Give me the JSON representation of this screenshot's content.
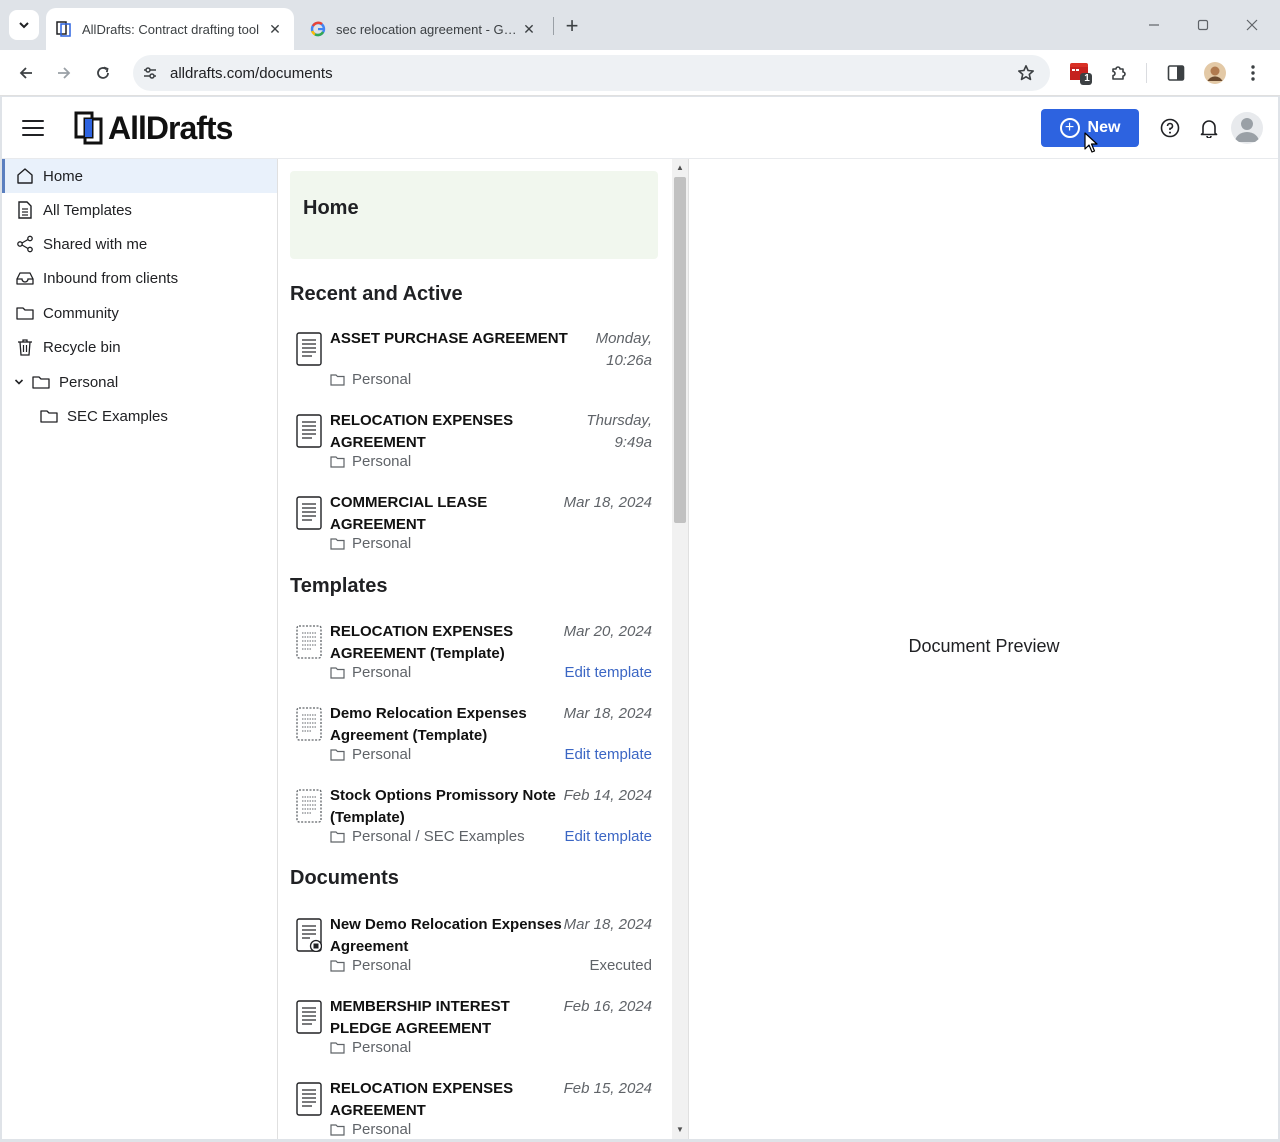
{
  "browser": {
    "tabs": [
      {
        "title": "AllDrafts: Contract drafting tool",
        "active": true
      },
      {
        "title": "sec relocation agreement - Google Search",
        "active": false
      }
    ],
    "url": "alldrafts.com/documents",
    "extension_badge": "1"
  },
  "app": {
    "logo_text": "AllDrafts",
    "new_button_label": "New",
    "brand_color": "#2d63e0"
  },
  "sidebar": {
    "items": [
      {
        "label": "Home",
        "icon": "home-icon"
      },
      {
        "label": "All Templates",
        "icon": "document-icon"
      },
      {
        "label": "Shared with me",
        "icon": "share-icon"
      },
      {
        "label": "Inbound from clients",
        "icon": "inbox-icon"
      },
      {
        "label": "Community",
        "icon": "folder-icon"
      },
      {
        "label": "Recycle bin",
        "icon": "trash-icon"
      },
      {
        "label": "Personal",
        "icon": "folder-icon"
      },
      {
        "label": "SEC Examples",
        "icon": "folder-icon"
      }
    ]
  },
  "home": {
    "title": "Home",
    "recent_title": "Recent and Active",
    "recent": [
      {
        "name": "ASSET PURCHASE AGREEMENT",
        "date": "Monday, 10:26a",
        "folder": "Personal"
      },
      {
        "name": "RELOCATION EXPENSES AGREEMENT",
        "date": "Thursday, 9:49a",
        "folder": "Personal"
      },
      {
        "name": "COMMERCIAL LEASE AGREEMENT",
        "date": "Mar 18, 2024",
        "folder": "Personal"
      }
    ],
    "templates_title": "Templates",
    "templates": [
      {
        "name": "RELOCATION EXPENSES AGREEMENT (Template)",
        "date": "Mar 20, 2024",
        "folder": "Personal",
        "action": "Edit template"
      },
      {
        "name": "Demo Relocation Expenses Agreement (Template)",
        "date": "Mar 18, 2024",
        "folder": "Personal",
        "action": "Edit template"
      },
      {
        "name": "Stock Options Promissory Note (Template)",
        "date": "Feb 14, 2024",
        "folder": "Personal / SEC Examples",
        "action": "Edit template"
      }
    ],
    "documents_title": "Documents",
    "documents": [
      {
        "name": "New Demo Relocation Expenses Agreement",
        "date": "Mar 18, 2024",
        "folder": "Personal",
        "status": "Executed"
      },
      {
        "name": "MEMBERSHIP INTEREST PLEDGE AGREEMENT",
        "date": "Feb 16, 2024",
        "folder": "Personal",
        "status": ""
      },
      {
        "name": "RELOCATION EXPENSES AGREEMENT",
        "date": "Feb 15, 2024",
        "folder": "Personal",
        "status": ""
      }
    ]
  },
  "preview": {
    "label": "Document Preview"
  }
}
